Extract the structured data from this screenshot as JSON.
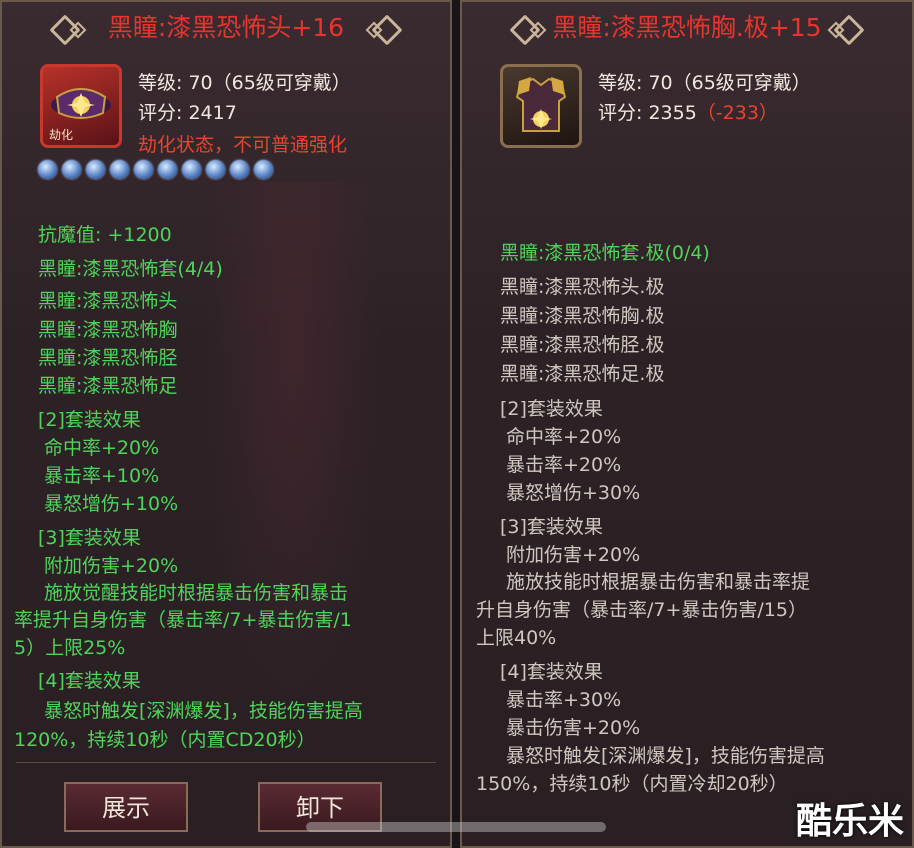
{
  "left": {
    "title": "黑瞳:漆黑恐怖头+16",
    "icon_tag": "劫化",
    "level": "等级: 70（65级可穿戴）",
    "score": "评分: 2417",
    "status": "劫化状态，不可普通强化",
    "gem_count": 10,
    "stat": "抗魔值: +1200",
    "set_title": "黑瞳:漆黑恐怖套(4/4)",
    "set_items": [
      "黑瞳:漆黑恐怖头",
      "黑瞳:漆黑恐怖胸",
      "黑瞳:漆黑恐怖胫",
      "黑瞳:漆黑恐怖足"
    ],
    "effect2_title": "[2]套装效果",
    "effect2": [
      "命中率+20%",
      "暴击率+10%",
      "暴怒增伤+10%"
    ],
    "effect3_title": "[3]套装效果",
    "effect3": [
      "附加伤害+20%",
      "施放觉醒技能时根据暴击伤害和暴击",
      "率提升自身伤害（暴击率/7+暴击伤害/1",
      "5）上限25%"
    ],
    "effect4_title": "[4]套装效果",
    "effect4": [
      "暴怒时触发[深渊爆发]，技能伤害提高",
      "120%，持续10秒（内置CD20秒）"
    ],
    "btn_show": "展示",
    "btn_remove": "卸下"
  },
  "right": {
    "title": "黑瞳:漆黑恐怖胸.极+15",
    "level": "等级: 70（65级可穿戴）",
    "score": "评分: 2355",
    "score_diff": "（-233）",
    "set_title": "黑瞳:漆黑恐怖套.极(0/4)",
    "set_items": [
      "黑瞳:漆黑恐怖头.极",
      "黑瞳:漆黑恐怖胸.极",
      "黑瞳:漆黑恐怖胫.极",
      "黑瞳:漆黑恐怖足.极"
    ],
    "effect2_title": "[2]套装效果",
    "effect2": [
      "命中率+20%",
      "暴击率+20%",
      "暴怒增伤+30%"
    ],
    "effect3_title": "[3]套装效果",
    "effect3": [
      "附加伤害+20%",
      "施放技能时根据暴击伤害和暴击率提",
      "升自身伤害（暴击率/7+暴击伤害/15）",
      "上限40%"
    ],
    "effect4_title": "[4]套装效果",
    "effect4": [
      "暴击率+30%",
      "暴击伤害+20%",
      "暴怒时触发[深渊爆发]，技能伤害提高",
      "150%，持续10秒（内置冷却20秒）"
    ]
  },
  "watermark": "酷乐米",
  "colors": {
    "title": "#e8342f",
    "green": "#4fd45a",
    "red": "#e8442f",
    "white": "#f0e8e0"
  }
}
